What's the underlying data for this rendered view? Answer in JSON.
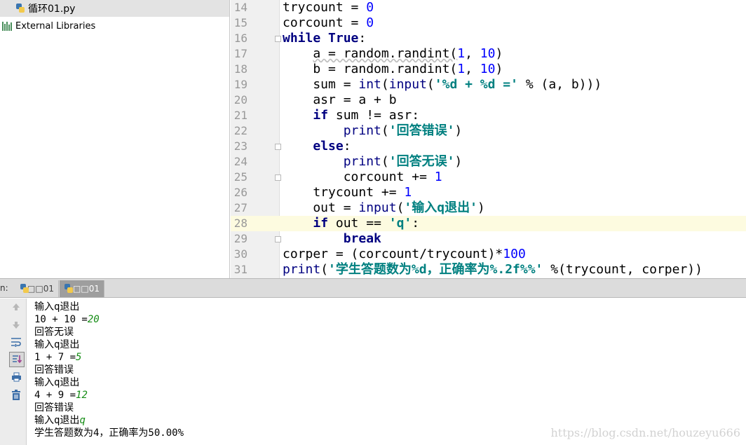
{
  "project_tree": {
    "file_name": "循环01.py",
    "libraries_label": "External Libraries"
  },
  "editor": {
    "current_line": 28,
    "lines": [
      {
        "n": "14",
        "tokens": [
          {
            "t": "trycount = "
          },
          {
            "t": "0",
            "c": "num"
          }
        ]
      },
      {
        "n": "15",
        "tokens": [
          {
            "t": "corcount = "
          },
          {
            "t": "0",
            "c": "num"
          }
        ]
      },
      {
        "n": "16",
        "fold": true,
        "tokens": [
          {
            "t": "while ",
            "c": "kw"
          },
          {
            "t": "True",
            "c": "kw"
          },
          {
            "t": ":"
          }
        ]
      },
      {
        "n": "17",
        "tokens": [
          {
            "t": "    "
          },
          {
            "t": "a = random.randint(",
            "c": "squig"
          },
          {
            "t": "1",
            "c": "num"
          },
          {
            "t": ", "
          },
          {
            "t": "10",
            "c": "num"
          },
          {
            "t": ")"
          }
        ]
      },
      {
        "n": "18",
        "tokens": [
          {
            "t": "    b = random.randint("
          },
          {
            "t": "1",
            "c": "num"
          },
          {
            "t": ", "
          },
          {
            "t": "10",
            "c": "num"
          },
          {
            "t": ")"
          }
        ]
      },
      {
        "n": "19",
        "tokens": [
          {
            "t": "    sum = "
          },
          {
            "t": "int",
            "c": "bi"
          },
          {
            "t": "("
          },
          {
            "t": "input",
            "c": "bi"
          },
          {
            "t": "("
          },
          {
            "t": "'%d + %d ='",
            "c": "str"
          },
          {
            "t": " % (a, b)))"
          }
        ]
      },
      {
        "n": "20",
        "tokens": [
          {
            "t": "    asr = a + b"
          }
        ]
      },
      {
        "n": "21",
        "tokens": [
          {
            "t": "    "
          },
          {
            "t": "if",
            "c": "kw"
          },
          {
            "t": " sum != asr:"
          }
        ]
      },
      {
        "n": "22",
        "tokens": [
          {
            "t": "        "
          },
          {
            "t": "print",
            "c": "bi"
          },
          {
            "t": "("
          },
          {
            "t": "'回答错误'",
            "c": "str"
          },
          {
            "t": ")"
          }
        ]
      },
      {
        "n": "23",
        "fold": true,
        "tokens": [
          {
            "t": "    "
          },
          {
            "t": "else",
            "c": "kw"
          },
          {
            "t": ":"
          }
        ]
      },
      {
        "n": "24",
        "tokens": [
          {
            "t": "        "
          },
          {
            "t": "print",
            "c": "bi"
          },
          {
            "t": "("
          },
          {
            "t": "'回答无误'",
            "c": "str"
          },
          {
            "t": ")"
          }
        ]
      },
      {
        "n": "25",
        "fold": true,
        "tokens": [
          {
            "t": "        corcount += "
          },
          {
            "t": "1",
            "c": "num"
          }
        ]
      },
      {
        "n": "26",
        "tokens": [
          {
            "t": "    trycount += "
          },
          {
            "t": "1",
            "c": "num"
          }
        ]
      },
      {
        "n": "27",
        "tokens": [
          {
            "t": "    out = "
          },
          {
            "t": "input",
            "c": "bi"
          },
          {
            "t": "("
          },
          {
            "t": "'输入q退出'",
            "c": "str"
          },
          {
            "t": ")"
          }
        ]
      },
      {
        "n": "28",
        "tokens": [
          {
            "t": "    "
          },
          {
            "t": "if",
            "c": "kw"
          },
          {
            "t": " out == "
          },
          {
            "t": "'q'",
            "c": "str"
          },
          {
            "t": ":"
          }
        ]
      },
      {
        "n": "29",
        "fold": true,
        "tokens": [
          {
            "t": "        "
          },
          {
            "t": "break",
            "c": "kw"
          }
        ]
      },
      {
        "n": "30",
        "tokens": [
          {
            "t": "corper = (corcount/trycount)*"
          },
          {
            "t": "100",
            "c": "num"
          }
        ]
      },
      {
        "n": "31",
        "tokens": [
          {
            "t": "print",
            "c": "bi"
          },
          {
            "t": "("
          },
          {
            "t": "'学生答题数为%d，正确率为%.2f%%'",
            "c": "str"
          },
          {
            "t": " %(trycount, corper))"
          }
        ]
      }
    ]
  },
  "run_window": {
    "label": "n:",
    "tabs": [
      {
        "label": "□□01",
        "active": false
      },
      {
        "label": "□□01",
        "active": true
      }
    ],
    "icons": [
      "up-arrow-icon",
      "down-arrow-icon",
      "soft-wrap-icon",
      "scroll-to-end-icon",
      "print-icon",
      "trash-icon"
    ]
  },
  "console": {
    "lines": [
      [
        {
          "t": "输入q退出"
        }
      ],
      [
        {
          "t": "10 + 10 ="
        },
        {
          "t": "20",
          "c": "cin"
        }
      ],
      [
        {
          "t": "回答无误"
        }
      ],
      [
        {
          "t": "输入q退出"
        }
      ],
      [
        {
          "t": "1 + 7 ="
        },
        {
          "t": "5",
          "c": "cin"
        }
      ],
      [
        {
          "t": "回答错误"
        }
      ],
      [
        {
          "t": "输入q退出"
        }
      ],
      [
        {
          "t": "4 + 9 ="
        },
        {
          "t": "12",
          "c": "cin"
        }
      ],
      [
        {
          "t": "回答错误"
        }
      ],
      [
        {
          "t": "输入q退出"
        },
        {
          "t": "q",
          "c": "cin"
        }
      ],
      [
        {
          "t": "学生答题数为4，正确率为50.00%"
        }
      ]
    ],
    "watermark": "https://blog.csdn.net/houzeyu666"
  }
}
